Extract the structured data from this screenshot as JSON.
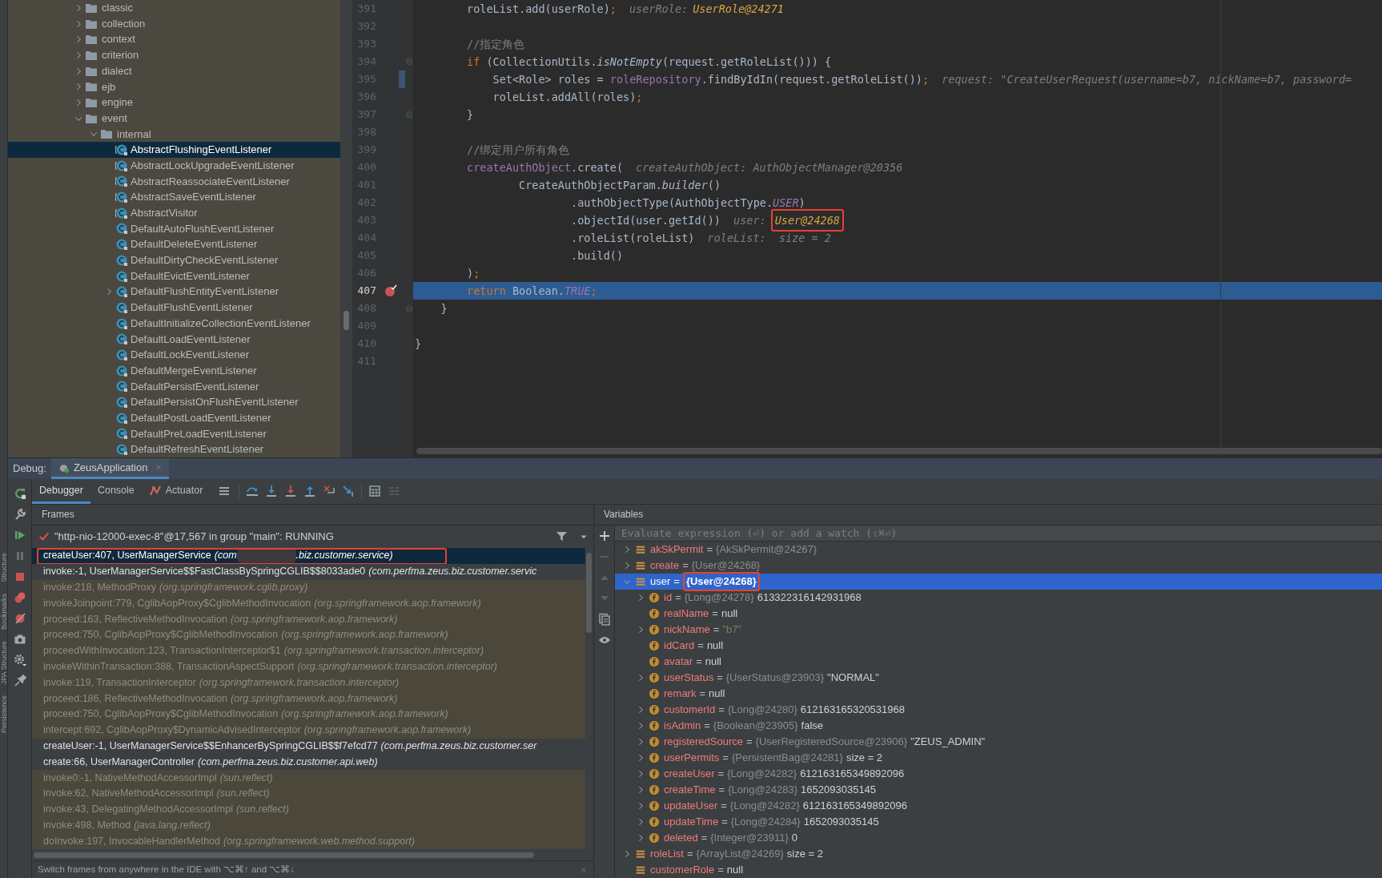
{
  "side_labels": [
    "Structure",
    "Bookmarks",
    "JPA Structure",
    "Persistence"
  ],
  "tree": [
    {
      "label": "classic",
      "kind": "folder",
      "selected": false,
      "expanded": false
    },
    {
      "label": "collection",
      "kind": "folder",
      "selected": false,
      "expanded": false
    },
    {
      "label": "context",
      "kind": "folder",
      "selected": false,
      "expanded": false
    },
    {
      "label": "criterion",
      "kind": "folder",
      "selected": false,
      "expanded": false
    },
    {
      "label": "dialect",
      "kind": "folder",
      "selected": false,
      "expanded": false
    },
    {
      "label": "ejb",
      "kind": "folder",
      "selected": false,
      "expanded": false
    },
    {
      "label": "engine",
      "kind": "folder",
      "selected": false,
      "expanded": false
    },
    {
      "label": "event",
      "kind": "folder",
      "selected": false,
      "expanded": true,
      "children": [
        {
          "label": "internal",
          "kind": "folder",
          "selected": false,
          "expanded": true,
          "children": [
            {
              "label": "AbstractFlushingEventListener",
              "kind": "abstract",
              "selected": true
            },
            {
              "label": "AbstractLockUpgradeEventListener",
              "kind": "abstract",
              "selected": false
            },
            {
              "label": "AbstractReassociateEventListener",
              "kind": "abstract",
              "selected": false
            },
            {
              "label": "AbstractSaveEventListener",
              "kind": "abstract",
              "selected": false
            },
            {
              "label": "AbstractVisitor",
              "kind": "abstract",
              "selected": false
            },
            {
              "label": "DefaultAutoFlushEventListener",
              "kind": "class",
              "selected": false
            },
            {
              "label": "DefaultDeleteEventListener",
              "kind": "class",
              "selected": false
            },
            {
              "label": "DefaultDirtyCheckEventListener",
              "kind": "class",
              "selected": false
            },
            {
              "label": "DefaultEvictEventListener",
              "kind": "class",
              "selected": false
            },
            {
              "label": "DefaultFlushEntityEventListener",
              "kind": "class",
              "selected": false,
              "expanded": false
            },
            {
              "label": "DefaultFlushEventListener",
              "kind": "class",
              "selected": false
            },
            {
              "label": "DefaultInitializeCollectionEventListener",
              "kind": "class",
              "selected": false
            },
            {
              "label": "DefaultLoadEventListener",
              "kind": "class",
              "selected": false
            },
            {
              "label": "DefaultLockEventListener",
              "kind": "class",
              "selected": false
            },
            {
              "label": "DefaultMergeEventListener",
              "kind": "class",
              "selected": false
            },
            {
              "label": "DefaultPersistEventListener",
              "kind": "class",
              "selected": false
            },
            {
              "label": "DefaultPersistOnFlushEventListener",
              "kind": "class",
              "selected": false
            },
            {
              "label": "DefaultPostLoadEventListener",
              "kind": "class",
              "selected": false
            },
            {
              "label": "DefaultPreLoadEventListener",
              "kind": "class",
              "selected": false
            },
            {
              "label": "DefaultRefreshEventListener",
              "kind": "class",
              "selected": false
            }
          ]
        }
      ]
    }
  ],
  "code": [
    {
      "number": "391",
      "segments": [
        {
          "kind": "plain",
          "text": "        roleList.add(userRole)"
        },
        {
          "kind": "keyword",
          "text": ";"
        },
        {
          "kind": "hint",
          "text": "userRole:"
        },
        {
          "kind": "hint_value",
          "text": "UserRole@24271",
          "highlighted": false
        }
      ]
    },
    {
      "number": "392"
    },
    {
      "number": "393",
      "segments": [
        {
          "kind": "comment",
          "text": "        //指定角色"
        }
      ]
    },
    {
      "number": "394",
      "fold_start": true,
      "segments": [
        {
          "kind": "keyword",
          "text": "        if"
        },
        {
          "kind": "plain",
          "text": " (CollectionUtils."
        },
        {
          "kind": "italic",
          "text": "isNotEmpty"
        },
        {
          "kind": "plain",
          "text": "(request.getRoleList())) {"
        }
      ]
    },
    {
      "number": "395",
      "changed": true,
      "segments": [
        {
          "kind": "plain",
          "text": "            Set<Role> roles = "
        },
        {
          "kind": "field",
          "text": "roleRepository"
        },
        {
          "kind": "plain",
          "text": ".findByIdIn(request.getRoleList())"
        },
        {
          "kind": "keyword",
          "text": ";"
        },
        {
          "kind": "hint",
          "text": "request: \"CreateUserRequest(username=b7, nickName=b7, password="
        }
      ]
    },
    {
      "number": "396",
      "segments": [
        {
          "kind": "plain",
          "text": "            roleList.addAll(roles)"
        },
        {
          "kind": "keyword",
          "text": ";"
        }
      ]
    },
    {
      "number": "397",
      "fold_end": true,
      "segments": [
        {
          "kind": "plain",
          "text": "        }"
        }
      ]
    },
    {
      "number": "398"
    },
    {
      "number": "399",
      "segments": [
        {
          "kind": "comment",
          "text": "        //绑定用户所有角色"
        }
      ]
    },
    {
      "number": "400",
      "segments": [
        {
          "kind": "field",
          "text": "        createAuthObject"
        },
        {
          "kind": "plain",
          "text": ".create("
        },
        {
          "kind": "hint",
          "text": "createAuthObject: AuthObjectManager@20356"
        }
      ]
    },
    {
      "number": "401",
      "segments": [
        {
          "kind": "plain",
          "text": "                CreateAuthObjectParam."
        },
        {
          "kind": "italic",
          "text": "builder"
        },
        {
          "kind": "plain",
          "text": "()"
        }
      ]
    },
    {
      "number": "402",
      "segments": [
        {
          "kind": "plain",
          "text": "                        .authObjectType(AuthObjectType."
        },
        {
          "kind": "field_italic",
          "text": "USER"
        },
        {
          "kind": "plain",
          "text": ")"
        }
      ]
    },
    {
      "number": "403",
      "segments": [
        {
          "kind": "plain",
          "text": "                        .objectId(user.getId())"
        },
        {
          "kind": "hint",
          "text": "user:"
        },
        {
          "kind": "hint_value",
          "text": "User@24268",
          "highlighted": true
        }
      ]
    },
    {
      "number": "404",
      "segments": [
        {
          "kind": "plain",
          "text": "                        .roleList(roleList)"
        },
        {
          "kind": "hint",
          "text": "roleList:  size = 2"
        }
      ]
    },
    {
      "number": "405",
      "segments": [
        {
          "kind": "plain",
          "text": "                        .build()"
        }
      ]
    },
    {
      "number": "406",
      "segments": [
        {
          "kind": "plain",
          "text": "        )"
        },
        {
          "kind": "keyword",
          "text": ";"
        }
      ]
    },
    {
      "number": "407",
      "breakpoint": true,
      "current": true,
      "segments": [
        {
          "kind": "keyword",
          "text": "        return"
        },
        {
          "kind": "plain",
          "text": " Boolean."
        },
        {
          "kind": "field_italic",
          "text": "TRUE"
        },
        {
          "kind": "keyword",
          "text": ";"
        }
      ]
    },
    {
      "number": "408",
      "fold_end": true,
      "segments": [
        {
          "kind": "plain",
          "text": "    }"
        }
      ]
    },
    {
      "number": "409"
    },
    {
      "number": "410",
      "segments": [
        {
          "kind": "plain",
          "text": "}"
        }
      ]
    },
    {
      "number": "411"
    }
  ],
  "debug": {
    "label": "Debug:",
    "session": "ZeusApplication",
    "tabs": [
      {
        "label": "Debugger",
        "selected": true
      },
      {
        "label": "Console",
        "selected": false
      },
      {
        "label": "Actuator",
        "selected": false
      }
    ],
    "frames_title": "Frames",
    "variables_title": "Variables",
    "thread": "\"http-nio-12000-exec-8\"@17,567 in group \"main\": RUNNING",
    "frames": [
      {
        "method": "createUser:407, UserManagerService",
        "package": "(com",
        "redacted": true,
        "package_end": ".biz.customer.service)",
        "kind": "user",
        "selected": true,
        "highlighted": true
      },
      {
        "method": "invoke:-1, UserManagerService$$FastClassBySpringCGLIB$$8033ade0",
        "package": "(com.perfma.zeus.biz.customer.servic",
        "kind": "user",
        "selected": false
      },
      {
        "method": "invoke:218, MethodProxy",
        "package": "(org.springframework.cglib.proxy)",
        "kind": "library",
        "selected": false
      },
      {
        "method": "invokeJoinpoint:779, CglibAopProxy$CglibMethodInvocation",
        "package": "(org.springframework.aop.framework)",
        "kind": "library",
        "selected": false
      },
      {
        "method": "proceed:163, ReflectiveMethodInvocation",
        "package": "(org.springframework.aop.framework)",
        "kind": "library",
        "selected": false
      },
      {
        "method": "proceed:750, CglibAopProxy$CglibMethodInvocation",
        "package": "(org.springframework.aop.framework)",
        "kind": "library",
        "selected": false
      },
      {
        "method": "proceedWithInvocation:123, TransactionInterceptor$1",
        "package": "(org.springframework.transaction.interceptor)",
        "kind": "library",
        "selected": false
      },
      {
        "method": "invokeWithinTransaction:388, TransactionAspectSupport",
        "package": "(org.springframework.transaction.interceptor)",
        "kind": "library",
        "selected": false
      },
      {
        "method": "invoke:119, TransactionInterceptor",
        "package": "(org.springframework.transaction.interceptor)",
        "kind": "library",
        "selected": false
      },
      {
        "method": "proceed:186, ReflectiveMethodInvocation",
        "package": "(org.springframework.aop.framework)",
        "kind": "library",
        "selected": false
      },
      {
        "method": "proceed:750, CglibAopProxy$CglibMethodInvocation",
        "package": "(org.springframework.aop.framework)",
        "kind": "library",
        "selected": false
      },
      {
        "method": "intercept:692, CglibAopProxy$DynamicAdvisedInterceptor",
        "package": "(org.springframework.aop.framework)",
        "kind": "library",
        "selected": false
      },
      {
        "method": "createUser:-1, UserManagerService$$EnhancerBySpringCGLIB$$f7efcd77",
        "package": "(com.perfma.zeus.biz.customer.ser",
        "kind": "user",
        "selected": false
      },
      {
        "method": "create:66, UserManagerController",
        "package": "(com.perfma.zeus.biz.customer.api.web)",
        "kind": "user",
        "selected": false
      },
      {
        "method": "invoke0:-1, NativeMethodAccessorImpl",
        "package": "(sun.reflect)",
        "kind": "library",
        "selected": false
      },
      {
        "method": "invoke:62, NativeMethodAccessorImpl",
        "package": "(sun.reflect)",
        "kind": "library",
        "selected": false
      },
      {
        "method": "invoke:43, DelegatingMethodAccessorImpl",
        "package": "(sun.reflect)",
        "kind": "library",
        "selected": false
      },
      {
        "method": "invoke:498, Method",
        "package": "(java.lang.reflect)",
        "kind": "library",
        "selected": false
      },
      {
        "method": "doInvoke:197, InvocableHandlerMethod",
        "package": "(org.springframework.web.method.support)",
        "kind": "library",
        "selected": false
      }
    ],
    "frames_hint": "Switch frames from anywhere in the IDE with ⌥⌘↑ and ⌥⌘↓",
    "watch_placeholder": "Evaluate expression (⏎) or add a watch (⇧⌘⏎)",
    "variables": [
      {
        "name": "akSkPermit",
        "op": "=",
        "type": "{AkSkPermit@24267}",
        "kind": "local",
        "selected": false,
        "expanded": false
      },
      {
        "name": "create",
        "op": "=",
        "type": "{User@24268}",
        "kind": "local",
        "selected": false,
        "expanded": false
      },
      {
        "name": "user",
        "op": "=",
        "type": "{User@24268}",
        "kind": "local",
        "selected": true,
        "expanded": true,
        "highlighted": true,
        "children": [
          {
            "name": "id",
            "op": "=",
            "type": "{Long@24278}",
            "value": "613322316142931968",
            "kind": "field",
            "selected": false,
            "expanded": false
          },
          {
            "name": "realName",
            "op": "=",
            "value": "null",
            "kind": "field",
            "selected": false
          },
          {
            "name": "nickName",
            "op": "=",
            "value": "\"b7\"",
            "string": true,
            "kind": "field",
            "selected": false,
            "expanded": false
          },
          {
            "name": "idCard",
            "op": "=",
            "value": "null",
            "kind": "field",
            "selected": false
          },
          {
            "name": "avatar",
            "op": "=",
            "value": "null",
            "kind": "field",
            "selected": false
          },
          {
            "name": "userStatus",
            "op": "=",
            "type": "{UserStatus@23903}",
            "value": "\"NORMAL\"",
            "kind": "field",
            "selected": false,
            "expanded": false
          },
          {
            "name": "remark",
            "op": "=",
            "value": "null",
            "kind": "field",
            "selected": false
          },
          {
            "name": "customerId",
            "op": "=",
            "type": "{Long@24280}",
            "value": "612163165320531968",
            "kind": "field",
            "selected": false,
            "expanded": false
          },
          {
            "name": "isAdmin",
            "op": "=",
            "type": "{Boolean@23905}",
            "value": "false",
            "kind": "field",
            "selected": false,
            "expanded": false
          },
          {
            "name": "registeredSource",
            "op": "=",
            "type": "{UserRegisteredSource@23906}",
            "value": "\"ZEUS_ADMIN\"",
            "kind": "field",
            "selected": false,
            "expanded": false
          },
          {
            "name": "userPermits",
            "op": "=",
            "type": "{PersistentBag@24281}",
            "value": " size = 2",
            "kind": "field",
            "selected": false,
            "expanded": false
          },
          {
            "name": "createUser",
            "op": "=",
            "type": "{Long@24282}",
            "value": "612163165349892096",
            "kind": "field",
            "selected": false,
            "expanded": false
          },
          {
            "name": "createTime",
            "op": "=",
            "type": "{Long@24283}",
            "value": "1652093035145",
            "kind": "field",
            "selected": false,
            "expanded": false
          },
          {
            "name": "updateUser",
            "op": "=",
            "type": "{Long@24282}",
            "value": "612163165349892096",
            "kind": "field",
            "selected": false,
            "expanded": false
          },
          {
            "name": "updateTime",
            "op": "=",
            "type": "{Long@24284}",
            "value": "1652093035145",
            "kind": "field",
            "selected": false,
            "expanded": false
          },
          {
            "name": "deleted",
            "op": "=",
            "type": "{Integer@23911}",
            "value": "0",
            "kind": "field",
            "selected": false,
            "expanded": false
          }
        ]
      },
      {
        "name": "roleList",
        "op": "=",
        "type": "{ArrayList@24269}",
        "value": " size = 2",
        "kind": "local",
        "selected": false,
        "expanded": false
      },
      {
        "name": "customerRole",
        "op": "=",
        "value": "null",
        "kind": "local",
        "selected": false
      }
    ]
  }
}
